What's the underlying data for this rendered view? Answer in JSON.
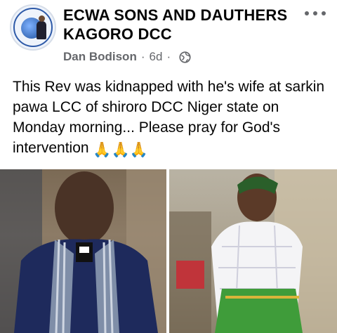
{
  "post": {
    "group_name_line1": "ECWA SONS AND DAUTHERS",
    "group_name_line2": "KAGORO DCC",
    "author": "Dan Bodison",
    "time": "6d",
    "separator": "·",
    "privacy_icon": "globe-icon",
    "more_icon": "more-options-icon",
    "text": "This Rev was kidnapped with he's wife at sarkin pawa LCC of shiroro DCC Niger state on Monday morning... Please pray for God's intervention",
    "emoji": "🙏🙏🙏"
  },
  "photos": [
    {
      "name": "photo-reverend",
      "subject": "man in clerical collar"
    },
    {
      "name": "photo-wife",
      "subject": "woman in white top and green wrapper"
    }
  ],
  "colors": {
    "text": "#050505",
    "meta": "#65676b",
    "background": "#ffffff"
  }
}
